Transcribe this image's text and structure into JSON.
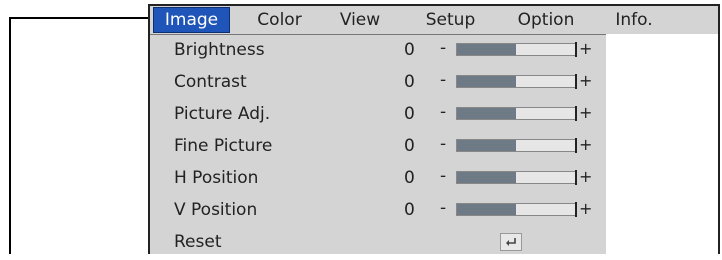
{
  "tabs": [
    {
      "label": "Image",
      "active": true
    },
    {
      "label": "Color",
      "active": false
    },
    {
      "label": "View",
      "active": false
    },
    {
      "label": "Setup",
      "active": false
    },
    {
      "label": "Option",
      "active": false
    },
    {
      "label": "Info.",
      "active": false
    }
  ],
  "menu": {
    "items": [
      {
        "label": "Brightness",
        "value": "0",
        "minus": "-",
        "plus": "+",
        "level": 0.5
      },
      {
        "label": "Contrast",
        "value": "0",
        "minus": "-",
        "plus": "+",
        "level": 0.5
      },
      {
        "label": "Picture Adj.",
        "value": "0",
        "minus": "-",
        "plus": "+",
        "level": 0.5
      },
      {
        "label": "Fine Picture",
        "value": "0",
        "minus": "-",
        "plus": "+",
        "level": 0.5
      },
      {
        "label": "H Position",
        "value": "0",
        "minus": "-",
        "plus": "+",
        "level": 0.5
      },
      {
        "label": "V Position",
        "value": "0",
        "minus": "-",
        "plus": "+",
        "level": 0.5
      }
    ],
    "reset": {
      "label": "Reset",
      "icon": "enter-key-icon"
    }
  },
  "colors": {
    "active_tab": "#1f55b8",
    "menu_bg": "#d4d4d4",
    "bar_fill": "#6e7b86"
  }
}
